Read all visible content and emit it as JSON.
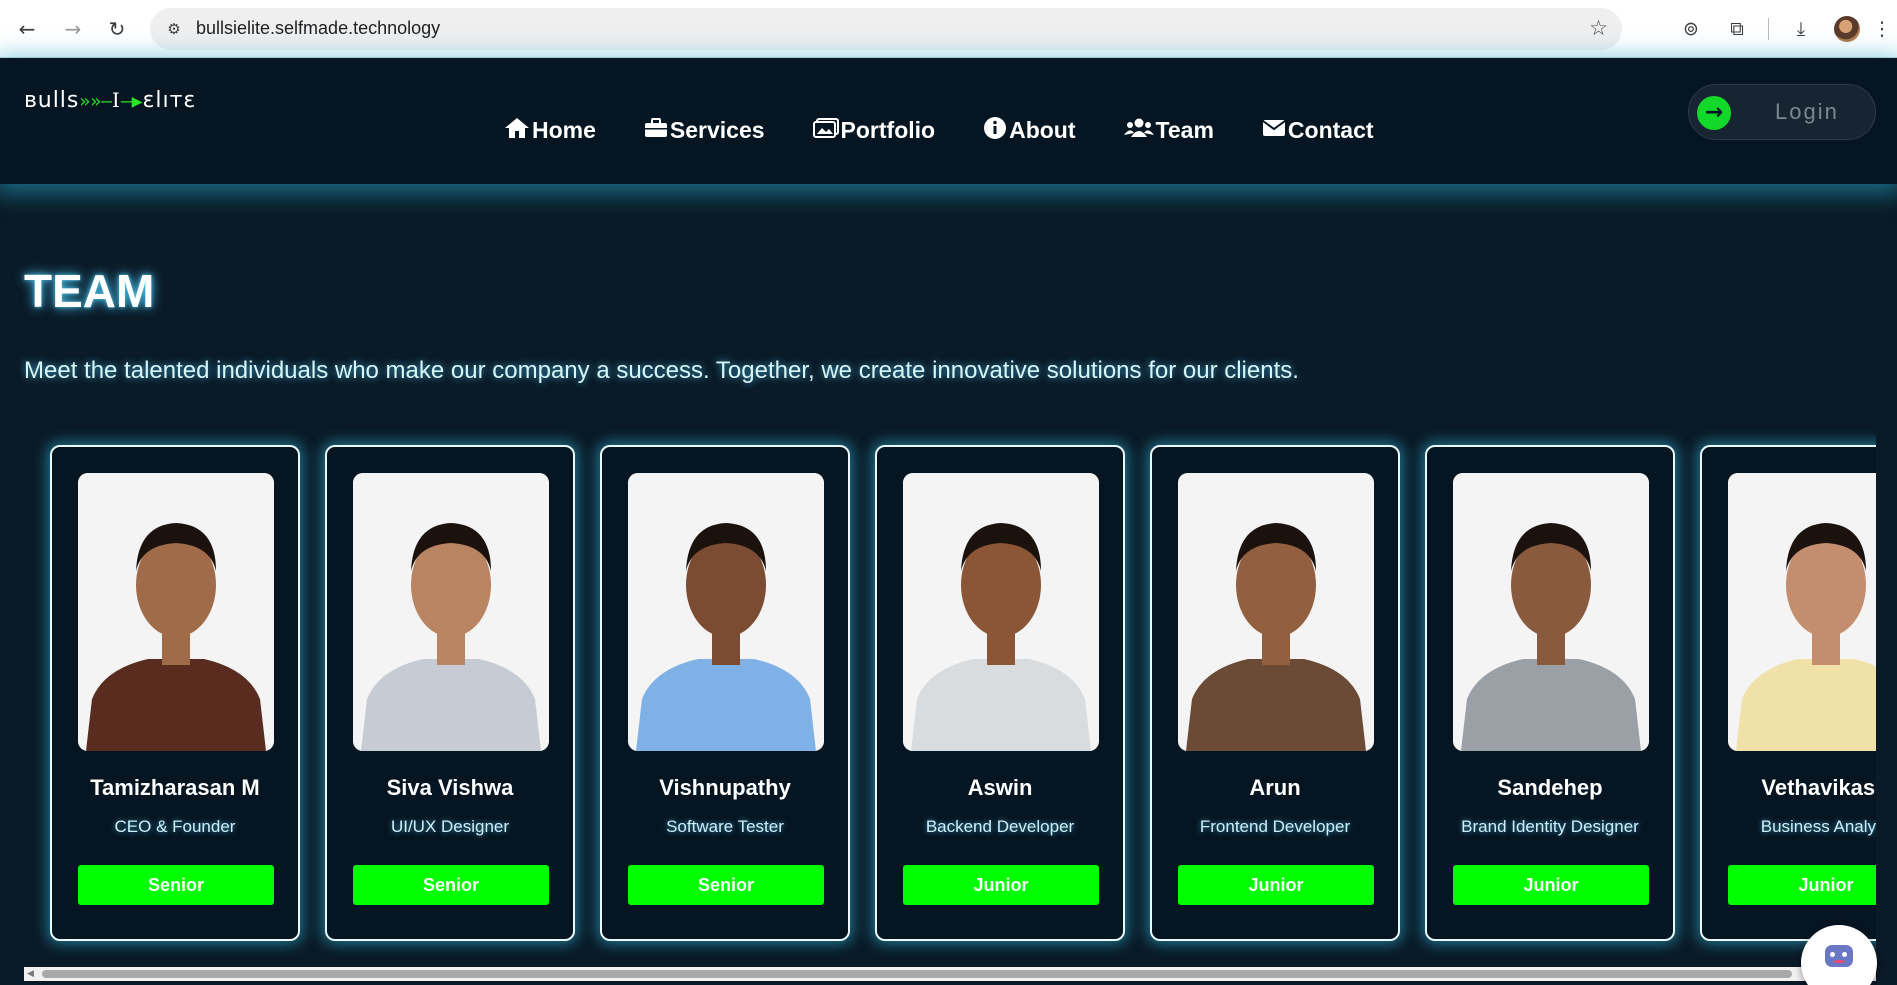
{
  "browser": {
    "url": "bullsielite.selfmade.technology",
    "icons": [
      "back-arrow-icon",
      "forward-arrow-icon",
      "reload-icon",
      "site-info-icon",
      "bookmark-star-icon",
      "extension-icon",
      "puzzle-icon",
      "download-icon",
      "profile-avatar",
      "more-menu-icon"
    ]
  },
  "header": {
    "logo": {
      "left": "ʙulls",
      "mid": "»»—",
      "bar": "I",
      "arrow": "—▶",
      "right": "ɛlıтɛ"
    },
    "nav": [
      {
        "label": "Home",
        "icon": "home-icon"
      },
      {
        "label": "Services",
        "icon": "briefcase-icon"
      },
      {
        "label": "Portfolio",
        "icon": "images-icon"
      },
      {
        "label": "About",
        "icon": "info-circle-icon"
      },
      {
        "label": "Team",
        "icon": "users-icon"
      },
      {
        "label": "Contact",
        "icon": "envelope-icon"
      }
    ],
    "login_label": "Login"
  },
  "team": {
    "title": "TEAM",
    "subtitle": "Meet the talented individuals who make our company a success. Together, we create innovative solutions for our clients.",
    "members": [
      {
        "name": "Tamizharasan M",
        "role": "CEO & Founder",
        "level": "Senior",
        "shirt": "#5a2c1f",
        "skin": "#a06b49"
      },
      {
        "name": "Siva Vishwa",
        "role": "UI/UX Designer",
        "level": "Senior",
        "shirt": "#c7ccd4",
        "skin": "#b88462"
      },
      {
        "name": "Vishnupathy",
        "role": "Software Tester",
        "level": "Senior",
        "shirt": "#7fb1e6",
        "skin": "#7b4b32"
      },
      {
        "name": "Aswin",
        "role": "Backend Developer",
        "level": "Junior",
        "shirt": "#d9dcdf",
        "skin": "#8a5636"
      },
      {
        "name": "Arun",
        "role": "Frontend Developer",
        "level": "Junior",
        "shirt": "#6b4a36",
        "skin": "#93603f"
      },
      {
        "name": "Sandehep",
        "role": "Brand Identity Designer",
        "level": "Junior",
        "shirt": "#9aa0a6",
        "skin": "#8a5a3e"
      },
      {
        "name": "Vethavikash",
        "role": "Business Analyst",
        "level": "Junior",
        "shirt": "#f0e1a8",
        "skin": "#c48e6e"
      }
    ]
  },
  "chat": {
    "icon": "chatbot-icon"
  }
}
